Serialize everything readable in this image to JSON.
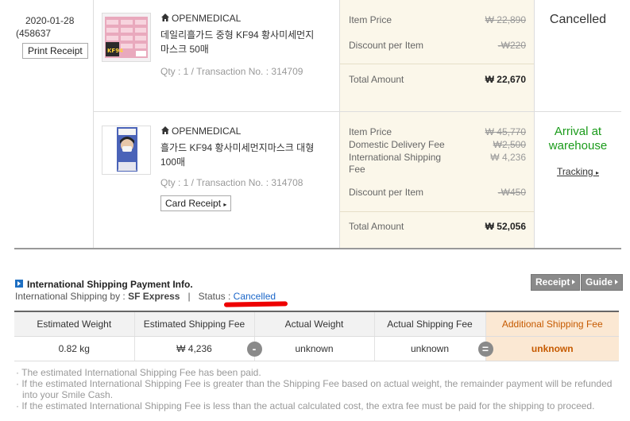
{
  "order": {
    "date": "2020-01-28",
    "order_no": "(458637",
    "print_receipt_label": "Print Receipt"
  },
  "items": [
    {
      "seller": "OPENMEDICAL",
      "name": "데일리흘가드 중형 KF94 황사미세먼지마스크 50매",
      "qty": "Qty : 1 / Transaction No. : 314709",
      "price_label": "Item Price",
      "price_value": "₩ 22,890",
      "discount_label": "Discount per Item",
      "discount_value": "-₩220",
      "total_label": "Total Amount",
      "total_value": "₩ 22,670",
      "status": "Cancelled"
    },
    {
      "seller": "OPENMEDICAL",
      "name": "흘가드 KF94 황사미세먼지마스크 대형 100매",
      "qty": "Qty : 1 / Transaction No. : 314708",
      "card_receipt_label": "Card Receipt",
      "price_label": "Item Price",
      "price_value": "₩ 45,770",
      "domestic_label": "Domestic Delivery Fee",
      "domestic_value": "₩2,500",
      "intl_label": "International Shipping Fee",
      "intl_value": "₩ 4,236",
      "discount_label": "Discount per Item",
      "discount_value": "-₩450",
      "total_label": "Total Amount",
      "total_value": "₩ 52,056",
      "status": "Arrival at warehouse",
      "tracking_label": "Tracking"
    }
  ],
  "shipping": {
    "title": "International Shipping Payment Info.",
    "by_label": "International Shipping by :",
    "by_value": "SF Express",
    "separator": "|",
    "status_label": "Status :",
    "status_value": "Cancelled",
    "receipt_button": "Receipt",
    "guide_button": "Guide",
    "headers": [
      "Estimated Weight",
      "Estimated Shipping Fee",
      "Actual Weight",
      "Actual Shipping Fee",
      "Additional Shipping Fee"
    ],
    "values": [
      "0.82 kg",
      "₩ 4,236",
      "unknown",
      "unknown",
      "unknown"
    ],
    "op_minus": "-",
    "op_equals": "=",
    "notes": [
      "· The estimated International Shipping Fee has been paid.",
      "· If the estimated International Shipping Fee is greater than the Shipping Fee based on actual weight, the remainder payment will be refunded into your Smile Cash.",
      "· If the estimated International Shipping Fee is less than the actual calculated cost, the extra fee must be paid for the shipping to proceed."
    ]
  },
  "colors": {
    "price_bg": "#fbf7ea",
    "status_green": "#1a9b1a",
    "link_blue": "#1b66c9",
    "highlight_bg": "#fbe8d3",
    "highlight_text": "#c65a00"
  }
}
